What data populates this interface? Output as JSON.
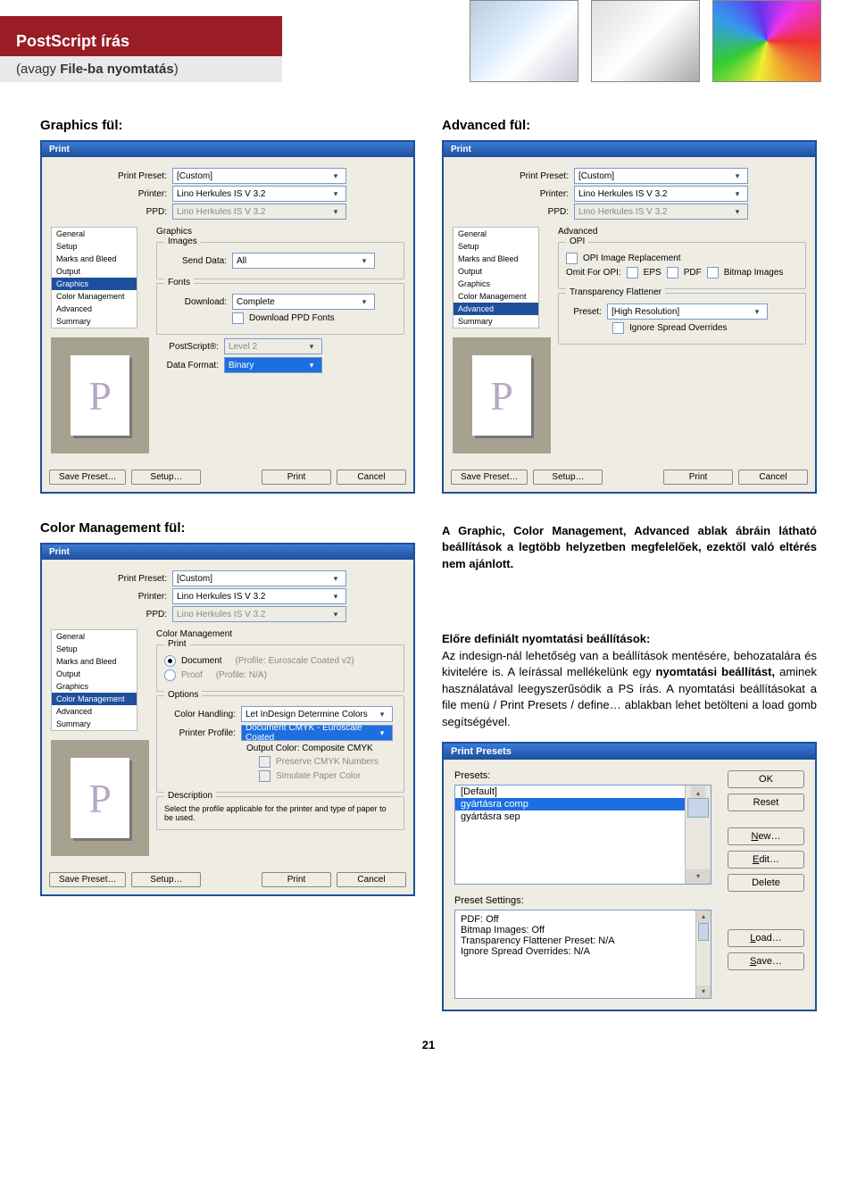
{
  "header": {
    "title": "PostScript írás",
    "subtitle_pre": "(avagy ",
    "subtitle_bold": "File-ba nyomtatás",
    "subtitle_post": ")"
  },
  "sections": {
    "graphics": "Graphics fül:",
    "advanced": "Advanced fül:",
    "colorMgmt": "Color Management fül:"
  },
  "dlg": {
    "title": "Print",
    "preset_lbl": "Print Preset:",
    "preset_val": "[Custom]",
    "printer_lbl": "Printer:",
    "printer_val": "Lino Herkules IS V 3.2",
    "ppd_lbl": "PPD:",
    "ppd_val": "Lino Herkules IS V 3.2",
    "side": [
      "General",
      "Setup",
      "Marks and Bleed",
      "Output",
      "Graphics",
      "Color Management",
      "Advanced",
      "Summary"
    ],
    "btn_save": "Save Preset…",
    "btn_setup": "Setup…",
    "btn_print": "Print",
    "btn_cancel": "Cancel"
  },
  "graphics": {
    "heading": "Graphics",
    "images": "Images",
    "send_lbl": "Send Data:",
    "send_val": "All",
    "fonts": "Fonts",
    "dl_lbl": "Download:",
    "dl_val": "Complete",
    "dl_cb": "Download PPD Fonts",
    "ps_lbl": "PostScript®:",
    "ps_val": "Level 2",
    "df_lbl": "Data Format:",
    "df_val": "Binary"
  },
  "advanced": {
    "heading": "Advanced",
    "opi": "OPI",
    "opi_cb": "OPI Image Replacement",
    "omit": "Omit For OPI:",
    "o1": "EPS",
    "o2": "PDF",
    "o3": "Bitmap Images",
    "tf": "Transparency Flattener",
    "preset_lbl": "Preset:",
    "preset_val": "[High Resolution]",
    "ignore": "Ignore Spread Overrides"
  },
  "cm": {
    "heading": "Color Management",
    "print": "Print",
    "doc": "Document",
    "doc_p": "(Profile: Euroscale Coated v2)",
    "proof": "Proof",
    "proof_p": "(Profile: N/A)",
    "options": "Options",
    "ch_lbl": "Color Handling:",
    "ch_val": "Let InDesign Determine Colors",
    "pp_lbl": "Printer Profile:",
    "pp_val": "Document CMYK - Euroscale Coated",
    "oc": "Output Color: Composite CMYK",
    "pn": "Preserve CMYK Numbers",
    "spc": "Simulate Paper Color",
    "desc": "Description",
    "desc_t": "Select the profile applicable for the printer and type of paper to be used."
  },
  "rightText": {
    "p1": "A Graphic, Color Management, Advanced ablak ábráin látható beállítások a legtöbb helyzetben megfelelőek, ezektől való eltérés nem ajánlott.",
    "h2": "Előre definiált nyomtatási beállítások:",
    "p2a": "Az indesign-nál lehetőség van a beállítások mentésére, behozatalára és kivitelére is. A leírással mellékelünk egy ",
    "p2b": "nyomtatási beállítást,",
    "p2c": " aminek használatával leegyszerűsödik a PS írás. A nyomtatási beállításokat a file menü / Print Presets / define… ablakban lehet betölteni a load gomb segítségével."
  },
  "pp": {
    "title": "Print Presets",
    "presets_lbl": "Presets:",
    "items": [
      "[Default]",
      "gyártásra comp",
      "gyártásra sep"
    ],
    "ps_lbl": "Preset Settings:",
    "lines": [
      "PDF: Off",
      "Bitmap Images: Off",
      "Transparency Flattener Preset: N/A",
      "Ignore Spread Overrides: N/A"
    ],
    "ok": "OK",
    "reset": "Reset",
    "new": "New…",
    "edit": "Edit…",
    "del": "Delete",
    "load": "Load…",
    "save": "Save…"
  },
  "pagenum": "21"
}
